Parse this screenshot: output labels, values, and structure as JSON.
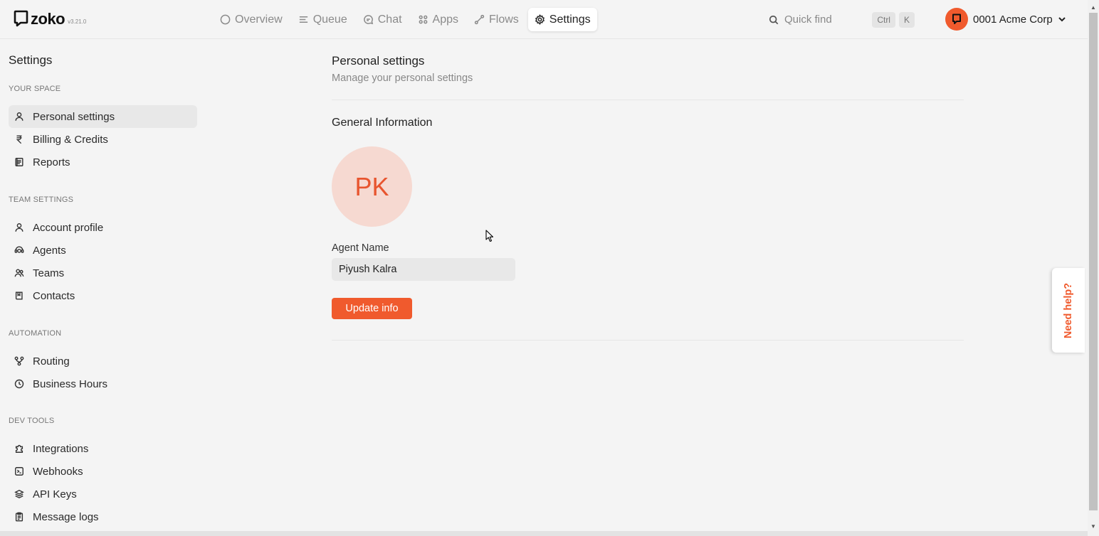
{
  "app": {
    "name": "zoko",
    "version": "v3.21.0"
  },
  "nav": [
    {
      "label": "Overview",
      "icon": "circle-icon"
    },
    {
      "label": "Queue",
      "icon": "queue-icon"
    },
    {
      "label": "Chat",
      "icon": "chat-icon"
    },
    {
      "label": "Apps",
      "icon": "apps-icon"
    },
    {
      "label": "Flows",
      "icon": "flows-icon"
    },
    {
      "label": "Settings",
      "icon": "gear-icon",
      "active": true
    }
  ],
  "quickfind": {
    "label": "Quick find",
    "keys": [
      "Ctrl",
      "K"
    ]
  },
  "org": {
    "name": "0001 Acme Corp"
  },
  "sidebar": {
    "title": "Settings",
    "sections": [
      {
        "label": "YOUR SPACE",
        "items": [
          {
            "label": "Personal settings",
            "icon": "user-icon",
            "active": true
          },
          {
            "label": "Billing & Credits",
            "icon": "rupee-icon"
          },
          {
            "label": "Reports",
            "icon": "report-icon"
          }
        ]
      },
      {
        "label": "TEAM SETTINGS",
        "items": [
          {
            "label": "Account profile",
            "icon": "user-icon"
          },
          {
            "label": "Agents",
            "icon": "agent-icon"
          },
          {
            "label": "Teams",
            "icon": "teams-icon"
          },
          {
            "label": "Contacts",
            "icon": "book-icon"
          }
        ]
      },
      {
        "label": "AUTOMATION",
        "items": [
          {
            "label": "Routing",
            "icon": "routing-icon"
          },
          {
            "label": "Business Hours",
            "icon": "clock-icon"
          }
        ]
      },
      {
        "label": "DEV TOOLS",
        "items": [
          {
            "label": "Integrations",
            "icon": "puzzle-icon"
          },
          {
            "label": "Webhooks",
            "icon": "terminal-icon"
          },
          {
            "label": "API Keys",
            "icon": "layers-icon"
          },
          {
            "label": "Message logs",
            "icon": "clipboard-icon"
          }
        ]
      }
    ]
  },
  "main": {
    "title": "Personal settings",
    "subtitle": "Manage your personal settings",
    "section_title": "General Information",
    "avatar_initials": "PK",
    "agent_name_label": "Agent Name",
    "agent_name_value": "Piyush Kalra",
    "update_button": "Update info"
  },
  "help": {
    "label": "Need help?"
  },
  "colors": {
    "accent": "#f05a2d",
    "avatar_bg": "#f6d9d1"
  }
}
